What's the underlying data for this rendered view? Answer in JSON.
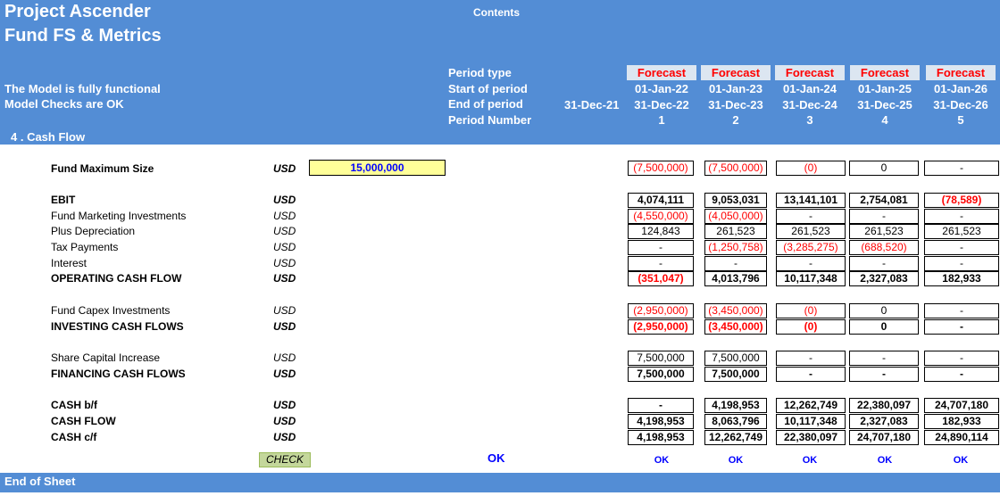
{
  "header": {
    "title_line1": "Project Ascender",
    "title_line2": "Fund FS & Metrics",
    "contents_link": "Contents",
    "status_line1": "The Model is fully functional",
    "status_line2": "Model Checks are OK",
    "section_title": "4 . Cash Flow",
    "row_labels": {
      "period_type": "Period type",
      "start": "Start of period",
      "end": "End of period",
      "number": "Period Number"
    },
    "opening_end_date": "31-Dec-21",
    "periods": [
      {
        "type": "Forecast",
        "start": "01-Jan-22",
        "end": "31-Dec-22",
        "number": "1"
      },
      {
        "type": "Forecast",
        "start": "01-Jan-23",
        "end": "31-Dec-23",
        "number": "2"
      },
      {
        "type": "Forecast",
        "start": "01-Jan-24",
        "end": "31-Dec-24",
        "number": "3"
      },
      {
        "type": "Forecast",
        "start": "01-Jan-25",
        "end": "31-Dec-25",
        "number": "4"
      },
      {
        "type": "Forecast",
        "start": "01-Jan-26",
        "end": "31-Dec-26",
        "number": "5"
      }
    ]
  },
  "fund_max": {
    "label": "Fund Maximum Size",
    "unit": "USD",
    "input_value": "15,000,000",
    "values": [
      "(7,500,000)",
      "(7,500,000)",
      "(0)",
      "0",
      "-"
    ]
  },
  "rows": [
    {
      "label": "EBIT",
      "unit": "USD",
      "values": [
        "4,074,111",
        "9,053,031",
        "13,141,101",
        "2,754,081",
        "(78,589)"
      ]
    },
    {
      "label": "Fund Marketing Investments",
      "unit": "USD",
      "values": [
        "(4,550,000)",
        "(4,050,000)",
        "-",
        "-",
        "-"
      ]
    },
    {
      "label": "Plus Depreciation",
      "unit": "USD",
      "values": [
        "124,843",
        "261,523",
        "261,523",
        "261,523",
        "261,523"
      ]
    },
    {
      "label": "Tax Payments",
      "unit": "USD",
      "values": [
        "-",
        "(1,250,758)",
        "(3,285,275)",
        "(688,520)",
        "-"
      ]
    },
    {
      "label": "Interest",
      "unit": "USD",
      "values": [
        "-",
        "-",
        "-",
        "-",
        "-"
      ]
    },
    {
      "label": "OPERATING CASH FLOW",
      "unit": "USD",
      "values": [
        "(351,047)",
        "4,013,796",
        "10,117,348",
        "2,327,083",
        "182,933"
      ]
    },
    {
      "label": "Fund Capex Investments",
      "unit": "USD",
      "values": [
        "(2,950,000)",
        "(3,450,000)",
        "(0)",
        "0",
        "-"
      ]
    },
    {
      "label": "INVESTING CASH FLOWS",
      "unit": "USD",
      "values": [
        "(2,950,000)",
        "(3,450,000)",
        "(0)",
        "0",
        "-"
      ]
    },
    {
      "label": "Share Capital Increase",
      "unit": "USD",
      "values": [
        "7,500,000",
        "7,500,000",
        "-",
        "-",
        "-"
      ]
    },
    {
      "label": "FINANCING CASH FLOWS",
      "unit": "USD",
      "values": [
        "7,500,000",
        "7,500,000",
        "-",
        "-",
        "-"
      ]
    },
    {
      "label": "CASH b/f",
      "unit": "USD",
      "values": [
        "-",
        "4,198,953",
        "12,262,749",
        "22,380,097",
        "24,707,180"
      ]
    },
    {
      "label": "CASH FLOW",
      "unit": "USD",
      "values": [
        "4,198,953",
        "8,063,796",
        "10,117,348",
        "2,327,083",
        "182,933"
      ]
    },
    {
      "label": "CASH c/f",
      "unit": "USD",
      "values": [
        "4,198,953",
        "12,262,749",
        "22,380,097",
        "24,707,180",
        "24,890,114"
      ]
    }
  ],
  "check": {
    "label": "CHECK",
    "overall": "OK",
    "period_checks": [
      "OK",
      "OK",
      "OK",
      "OK",
      "OK"
    ]
  },
  "footer": {
    "label": "End of Sheet"
  },
  "colors": {
    "band": "#538DD5",
    "negative": "#FF0000",
    "ok": "#0000FF",
    "input_bg": "#FFFF99",
    "check_bg": "#C4D79B"
  }
}
